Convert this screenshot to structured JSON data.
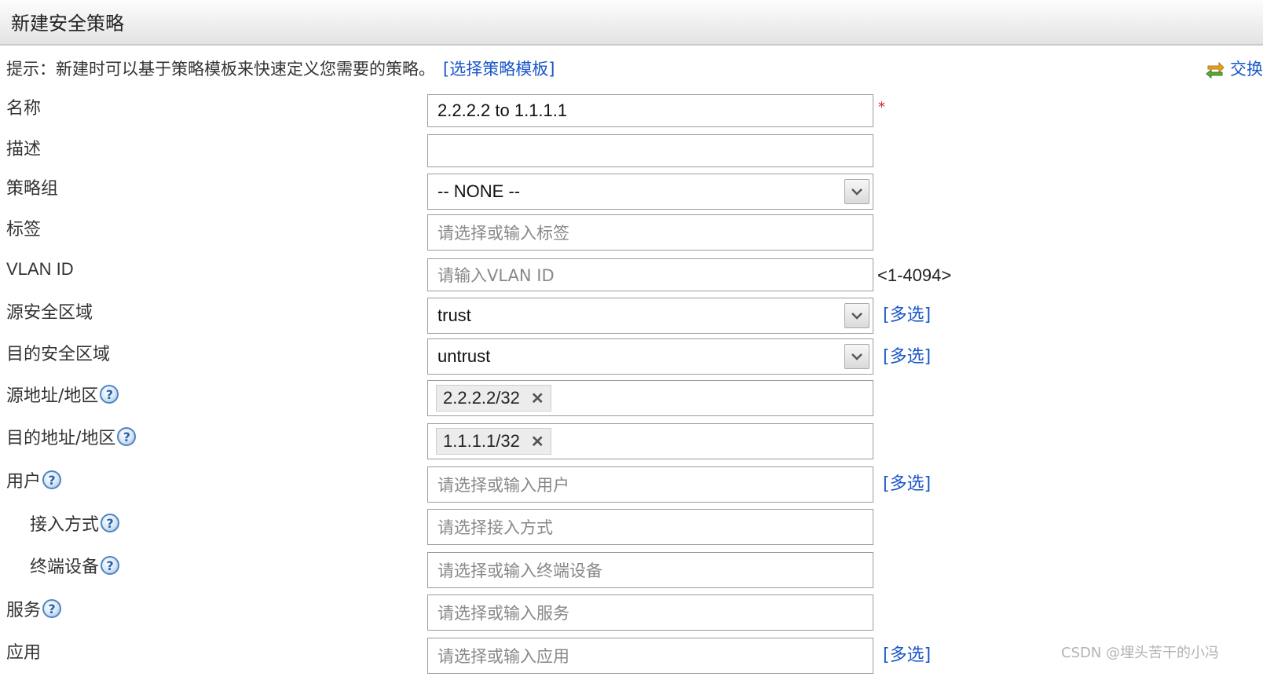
{
  "window": {
    "title": "新建安全策略"
  },
  "hint": {
    "text": "提示：新建时可以基于策略模板来快速定义您需要的策略。",
    "link": "[选择策略模板]"
  },
  "swap": {
    "label": "交换",
    "icon": "swap-arrows-icon"
  },
  "form": {
    "name": {
      "label": "名称",
      "value": "2.2.2.2 to 1.1.1.1",
      "required_mark": "*"
    },
    "description": {
      "label": "描述",
      "value": ""
    },
    "policy_group": {
      "label": "策略组",
      "value": "-- NONE --"
    },
    "tag": {
      "label": "标签",
      "placeholder": "请选择或输入标签"
    },
    "vlan": {
      "label": "VLAN ID",
      "placeholder": "请输入VLAN ID",
      "range": "<1-4094>"
    },
    "src_zone": {
      "label": "源安全区域",
      "value": "trust",
      "multi": "[多选]"
    },
    "dst_zone": {
      "label": "目的安全区域",
      "value": "untrust",
      "multi": "[多选]"
    },
    "src_addr": {
      "label": "源地址/地区",
      "tags": [
        "2.2.2.2/32"
      ]
    },
    "dst_addr": {
      "label": "目的地址/地区",
      "tags": [
        "1.1.1.1/32"
      ]
    },
    "user": {
      "label": "用户",
      "placeholder": "请选择或输入用户",
      "multi": "[多选]"
    },
    "access": {
      "label": "接入方式",
      "placeholder": "请选择接入方式"
    },
    "terminal": {
      "label": "终端设备",
      "placeholder": "请选择或输入终端设备"
    },
    "service": {
      "label": "服务",
      "placeholder": "请选择或输入服务"
    },
    "application": {
      "label": "应用",
      "placeholder": "请选择或输入应用",
      "multi": "[多选]"
    }
  },
  "icons": {
    "help": "?",
    "tag_remove": "✕"
  },
  "watermark": "CSDN @埋头苦干的小冯"
}
